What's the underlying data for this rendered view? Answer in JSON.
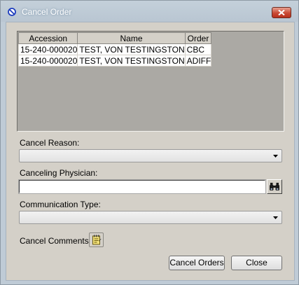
{
  "window": {
    "title": "Cancel Order",
    "app_icon": "no-entry-icon",
    "close_icon": "close-icon"
  },
  "orders_grid": {
    "columns": [
      "Accession",
      "Name",
      "Order"
    ],
    "rows": [
      [
        "15-240-000020",
        "TEST, VON TESTINGSTON",
        "CBC"
      ],
      [
        "15-240-000020",
        "TEST, VON TESTINGSTON",
        "ADIFF"
      ]
    ]
  },
  "cancel_reason": {
    "label": "Cancel Reason:",
    "value": ""
  },
  "canceling_physician": {
    "label": "Canceling Physician:",
    "value": "",
    "search_icon": "binoculars-icon"
  },
  "communication_type": {
    "label": "Communication Type:",
    "value": ""
  },
  "cancel_comments": {
    "label": "Cancel Comments:",
    "icon": "notepad-icon"
  },
  "buttons": {
    "cancel_orders": "Cancel Orders",
    "close": "Close"
  }
}
